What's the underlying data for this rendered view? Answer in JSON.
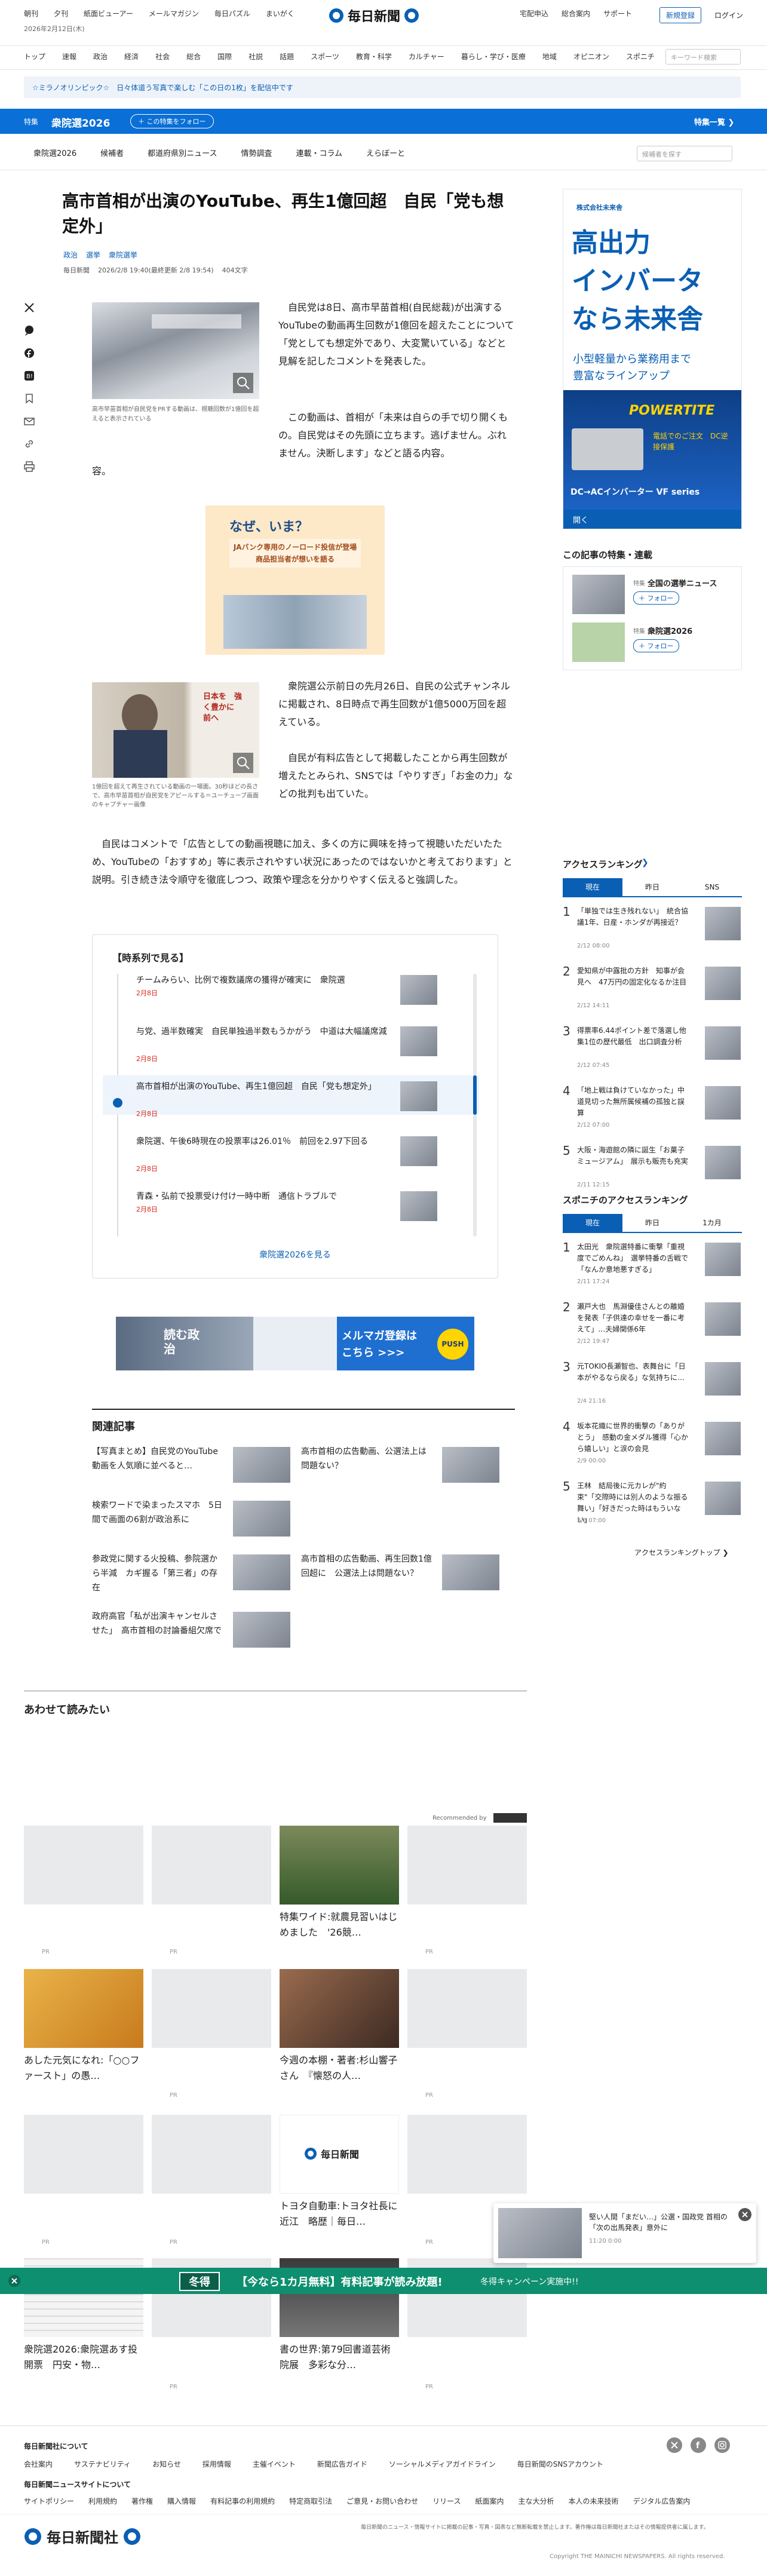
{
  "topbar": {
    "left": [
      "朝刊",
      "夕刊",
      "紙面ビューアー",
      "メールマガジン",
      "毎日パズル",
      "まいがく"
    ],
    "date": "2026年2月12日(木)",
    "logo": "毎日新聞",
    "right": [
      "宅配申込",
      "総合案内",
      "サポート"
    ],
    "register": "新規登録",
    "login": "ログイン"
  },
  "mainnav": {
    "items": [
      "トップ",
      "速報",
      "政治",
      "経済",
      "社会",
      "総合",
      "国際",
      "社説",
      "話題",
      "スポーツ",
      "教育・科学",
      "カルチャー",
      "暮らし・学び・医療",
      "地域",
      "オピニオン",
      "スポニチ"
    ],
    "search_placeholder": "キーワード検索"
  },
  "notice": "☆ミラノオリンピック☆　日々体道う写真で楽しむ「この日の1枚」を配信中です",
  "feature": {
    "tag": "特集",
    "title": "衆院選2026",
    "follow": "＋ この特集をフォロー",
    "link": "特集一覧 ❯",
    "tabs": [
      "衆院選2026",
      "候補者",
      "都道府県別ニュース",
      "情勢調査",
      "連載・コラム",
      "えらぼーと"
    ],
    "search_placeholder": "候補者を探す"
  },
  "article": {
    "title": "高市首相が出演のYouTube、再生1億回超　自民「党も想定外」",
    "tags": [
      "政治",
      "選挙",
      "衆院選挙"
    ],
    "meta": [
      "毎日新聞",
      "2026/2/8 19:40(最終更新 2/8 19:54)",
      "404文字"
    ],
    "img1_caption": "高市早苗首相が自民党をPRする動画は、視聴回数が1億回を超えると表示されている",
    "p1": "自民党は8日、高市早苗首相(自民総裁)が出演するYouTubeの動画再生回数が1億回を超えたことについて「党としても想定外であり、大変驚いている」などと見解を記したコメントを発表した。",
    "p2": "この動画は、首相が「未来は自らの手で切り開くもの。自民党はその先頭に立ちます。逃げません。ぶれません。決断します」などと語る内容。",
    "p2_end": "容。",
    "ad_title": "なぜ、いま？",
    "ad_sub": "JAバンク専用のノーロード投信が登場 商品担当者が想いを語る",
    "img2_caption": "1億回を超えて再生されている動画の一場面。30秒ほどの長さで、高市早苗首相が自民党をアピールする＝ユーチューブ画面のキャプチャー画像",
    "img2_text": "日本を　強く豊かに　前へ",
    "p3": "衆院選公示前日の先月26日、自民の公式チャンネルに掲載され、8日時点で再生回数が1億5000万回を超えている。",
    "p4": "自民が有料広告として掲載したことから再生回数が増えたとみられ、SNSでは「やりすぎ」「お金の力」などの批判も出ていた。",
    "p5": "自民はコメントで「広告としての動画視聴に加え、多くの方に興味を持って視聴いただいたため、YouTubeの「おすすめ」等に表示されやすい状況にあったのではないかと考えております」と説明。引き続き法令順守を徹底しつつ、政策や理念を分かりやすく伝えると強調した。"
  },
  "timeline": {
    "header": "【時系列で見る】",
    "items": [
      {
        "title": "チームみらい、比例で複数議席の獲得が確実に　衆院選",
        "date": "2月8日"
      },
      {
        "title": "与党、過半数確実　自民単独過半数もうかがう　中道は大幅議席減",
        "date": "2月8日"
      },
      {
        "title": "高市首相が出演のYouTube、再生1億回超　自民「党も想定外」",
        "date": "2月8日"
      },
      {
        "title": "衆院選、午後6時現在の投票率は26.01％　前回を2.97下回る",
        "date": "2月8日"
      },
      {
        "title": "青森・弘前で投票受け付け一時中断　通信トラブルで",
        "date": "2月8日"
      }
    ],
    "more": "衆院選2026を見る"
  },
  "banner": {
    "left": "読む政治",
    "right1": "メルマガ登録は",
    "right2": "こちら >>>",
    "badge": "PUSH"
  },
  "related": {
    "header": "関連記事",
    "items": [
      "【写真まとめ】自民党のYouTube 動画を人気順に並べると…",
      "高市首相の広告動画、公選法上は問題ない？",
      "検索ワードで染まったスマホ　5日間で画面の6割が政治系に",
      "参政党に関する火投稿、参院選から半減　カギ握る「第三者」の存在",
      "高市首相の広告動画、再生回数1億回超に　公選法上は問題ない？",
      "政府高官「私が出演キャンセルさせた」　高市首相の討論番組欠席で"
    ]
  },
  "awasete": {
    "header": "あわせて読みたい",
    "rec_by": "Recommended by",
    "items": [
      "特集ワイド:就農見習いはじめました　'26競…",
      "あした元気になれ:「○○ファースト」の愚…",
      "今週の本棚・著者:杉山響子さん　『懐怒の人…",
      "トヨタ自動車:トヨタ社長に近江　略歴｜毎日…",
      "衆院選2026:衆院選あす投開票　円安・物…",
      "書の世界:第79回書道芸術院展　多彩な分…"
    ],
    "pr": "PR"
  },
  "ad_right": {
    "company": "株式会社未来舎",
    "line1": "高出力",
    "line2": "インバータ",
    "line3": "なら未来舎",
    "line4": "小型軽量から業務用まで",
    "line5": "豊富なラインアップ",
    "brand": "POWERTITE",
    "phone": "電話でのご注文　DC逆接保護",
    "vf": "DC→ACインバーター VF series",
    "open": "開く"
  },
  "sidefeature": {
    "header": "この記事の特集・連載",
    "items": [
      {
        "tag": "特集",
        "title": "全国の選挙ニュース",
        "follow": "＋ フォロー"
      },
      {
        "tag": "特集",
        "title": "衆院選2026",
        "follow": "＋ フォロー"
      }
    ]
  },
  "ranking": {
    "header": "アクセスランキング",
    "tabs": [
      "現在",
      "昨日",
      "SNS"
    ],
    "items": [
      {
        "n": "1",
        "t": "「単独では生き残れない」　統合協議1年、日産・ホンダが再接近？",
        "d": "2/12 08:00"
      },
      {
        "n": "2",
        "t": "愛知県が中露批の方針　知事が会見へ　47万円の固定化なるか注目",
        "d": "2/12 14:11"
      },
      {
        "n": "3",
        "t": "得票率6.44ポイント差で落選し他集1位の歴代最低　出口調査分析",
        "d": "2/12 07:45"
      },
      {
        "n": "4",
        "t": "「地上戦は負けていなかった」中道見切った無所属候補の孤独と誤算",
        "d": "2/12 07:00"
      },
      {
        "n": "5",
        "t": "大阪・海遊館の隣に誕生「お菓子ミュージアム」　展示も販売も充実",
        "d": "2/11 12:15"
      }
    ]
  },
  "sponichi": {
    "header": "スポニチのアクセスランキング",
    "tabs": [
      "現在",
      "昨日",
      "1カ月"
    ],
    "items": [
      {
        "n": "1",
        "t": "太田光　衆院選特番に衝撃「重視度でごめんね」　選挙特番の舌戦で「なんか意地悪すぎる」",
        "d": "2/11 17:24"
      },
      {
        "n": "2",
        "t": "瀬戸大也　馬淵優佳さんとの離婚を発表「子供達の幸せを一番に考えて」…夫婦関係6年",
        "d": "2/12 19:47"
      },
      {
        "n": "3",
        "t": "元TOKIO長瀬智也、表舞台に「日本がやるなら戻る」な気持ちに…",
        "d": "2/4 21:16"
      },
      {
        "n": "4",
        "t": "坂本花織に世界的衝撃の「ありがとう」　感動の金メダル獲得「心から嬉しい」と涙の会見",
        "d": "2/9 00:00"
      },
      {
        "n": "5",
        "t": "王林　結局後に元カレが\"約束\"「交際時には別人のような振る舞い」「好きだった時はもういない」",
        "d": "2/8 07:00"
      }
    ],
    "more": "アクセスランキングトップ ❯"
  },
  "popup": {
    "t": "堅い人間「まだい…」公選・国政党 首相の「次の出馬発表」意外に",
    "time": "11:20 0:00"
  },
  "campaign": {
    "badge": "冬得",
    "text": "【今なら1カ月無料】有料記事が読み放題!",
    "sub": "冬得キャンペーン実施中!!"
  },
  "footer": {
    "h1": "毎日新聞社について",
    "row1": [
      "会社案内",
      "サステナビリティ",
      "お知らせ",
      "採用情報",
      "主催イベント",
      "新聞広告ガイド",
      "ソーシャルメディアガイドライン",
      "毎日新聞のSNSアカウント"
    ],
    "h2": "毎日新聞ニュースサイトについて",
    "row2": [
      "サイトポリシー",
      "利用規約",
      "著作権",
      "購入情報",
      "有料記事の利用規約",
      "特定商取引法",
      "ご意見・お問い合わせ",
      "リリース",
      "紙面案内",
      "主な大分析",
      "本人の未来技術",
      "デジタル広告案内"
    ],
    "logo": "毎日新聞社",
    "legal": "毎日新聞のニュース・情報サイトに掲載の記事・写真・図表など無断転載を禁止します。著作権は毎日新聞社またはその情報提供者に属します。",
    "copy": "Copyright THE MAINICHI NEWSPAPERS. All rights reserved."
  },
  "colors": {
    "blue": "#0a5fb4",
    "feature": "#0a6fd6",
    "red": "#d9261c",
    "campaign": "#0e8f6f"
  }
}
